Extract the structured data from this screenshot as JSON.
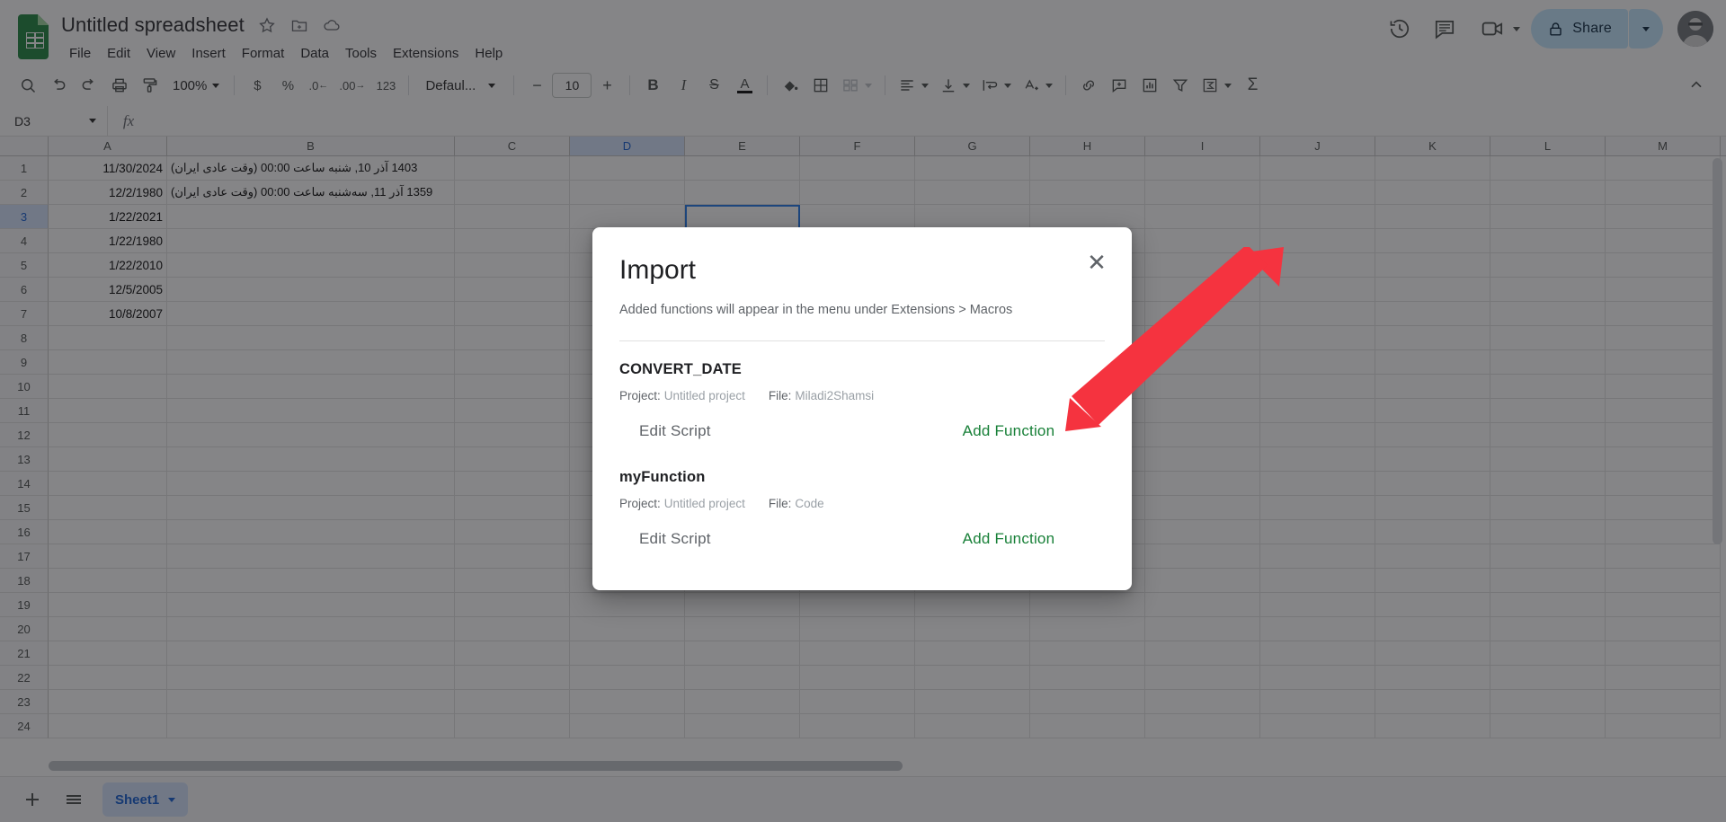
{
  "app": {
    "doc_title": "Untitled spreadsheet",
    "logo_name": "google-sheets-logo"
  },
  "header": {
    "title_icons": [
      {
        "name": "star-icon",
        "glyph": "☆"
      },
      {
        "name": "move-to-folder-icon",
        "glyph": "▣"
      },
      {
        "name": "cloud-saved-icon",
        "glyph": "☁"
      }
    ],
    "menus": [
      {
        "label": "File"
      },
      {
        "label": "Edit"
      },
      {
        "label": "View"
      },
      {
        "label": "Insert"
      },
      {
        "label": "Format"
      },
      {
        "label": "Data"
      },
      {
        "label": "Tools"
      },
      {
        "label": "Extensions"
      },
      {
        "label": "Help"
      }
    ],
    "right": {
      "history_icon": "version-history-icon",
      "comment_icon": "comment-history-icon",
      "meet_icon": "google-meet-icon",
      "share_label": "Share",
      "share_lock_icon": "lock-icon",
      "avatar": "account-avatar"
    }
  },
  "toolbar": {
    "zoom_value": "100%",
    "font_value": "Defaul...",
    "font_size": "10",
    "currency_glyph": "$",
    "percent_glyph": "%",
    "dec_dec_glyph": ".0",
    "dec_inc_glyph": ".00",
    "formats_glyph": "123",
    "bold_glyph": "B",
    "italic_glyph": "I",
    "strike_glyph": "S",
    "textcolor_glyph": "A",
    "minus_glyph": "−",
    "plus_glyph": "+",
    "sum_glyph": "Σ",
    "items": [
      {
        "name": "search-icon"
      },
      {
        "name": "undo-icon"
      },
      {
        "name": "redo-icon"
      },
      {
        "name": "print-icon"
      },
      {
        "name": "paint-format-icon"
      },
      {
        "name": "fill-color-icon"
      },
      {
        "name": "borders-icon"
      },
      {
        "name": "merge-cells-icon"
      },
      {
        "name": "horizontal-align-icon"
      },
      {
        "name": "vertical-align-icon"
      },
      {
        "name": "text-wrapping-icon"
      },
      {
        "name": "text-rotation-icon"
      },
      {
        "name": "insert-link-icon"
      },
      {
        "name": "insert-comment-icon"
      },
      {
        "name": "insert-chart-icon"
      },
      {
        "name": "create-filter-icon"
      },
      {
        "name": "functions-icon"
      },
      {
        "name": "collapse-toolbar-icon"
      }
    ]
  },
  "formula_bar": {
    "name_box": "D3",
    "fx_glyph": "fx",
    "formula_value": ""
  },
  "grid": {
    "columns": [
      "A",
      "B",
      "C",
      "D",
      "E",
      "F",
      "G",
      "H",
      "I",
      "J",
      "K",
      "L",
      "M"
    ],
    "selected_column": "D",
    "selected_row": 3,
    "selected_cell": "D3",
    "rows": [
      {
        "num": "1",
        "a": "11/30/2024",
        "b": "1403 آذر 10, شنبه ساعت 00:00 (وقت عادی ایران)"
      },
      {
        "num": "2",
        "a": "12/2/1980",
        "b": "1359 آذر 11, سه‌شنبه ساعت 00:00 (وقت عادی ایران)"
      },
      {
        "num": "3",
        "a": "1/22/2021",
        "b": ""
      },
      {
        "num": "4",
        "a": "1/22/1980",
        "b": ""
      },
      {
        "num": "5",
        "a": "1/22/2010",
        "b": ""
      },
      {
        "num": "6",
        "a": "12/5/2005",
        "b": ""
      },
      {
        "num": "7",
        "a": "10/8/2007",
        "b": ""
      },
      {
        "num": "8",
        "a": "",
        "b": ""
      },
      {
        "num": "9",
        "a": "",
        "b": ""
      },
      {
        "num": "10",
        "a": "",
        "b": ""
      },
      {
        "num": "11",
        "a": "",
        "b": ""
      },
      {
        "num": "12",
        "a": "",
        "b": ""
      },
      {
        "num": "13",
        "a": "",
        "b": ""
      },
      {
        "num": "14",
        "a": "",
        "b": ""
      },
      {
        "num": "15",
        "a": "",
        "b": ""
      },
      {
        "num": "16",
        "a": "",
        "b": ""
      },
      {
        "num": "17",
        "a": "",
        "b": ""
      },
      {
        "num": "18",
        "a": "",
        "b": ""
      },
      {
        "num": "19",
        "a": "",
        "b": ""
      },
      {
        "num": "20",
        "a": "",
        "b": ""
      },
      {
        "num": "21",
        "a": "",
        "b": ""
      },
      {
        "num": "22",
        "a": "",
        "b": ""
      },
      {
        "num": "23",
        "a": "",
        "b": ""
      },
      {
        "num": "24",
        "a": "",
        "b": ""
      }
    ]
  },
  "sheetbar": {
    "add_label": "+",
    "all_sheets_icon": "all-sheets-icon",
    "tab_label": "Sheet1"
  },
  "modal": {
    "title": "Import",
    "subtitle": "Added functions will appear in the menu under Extensions > Macros",
    "close_glyph": "✕",
    "project_label": "Project:",
    "file_label": "File:",
    "functions": [
      {
        "name": "CONVERT_DATE",
        "project": "Untitled project",
        "file": "Miladi2Shamsi",
        "edit_label": "Edit Script",
        "add_label": "Add Function"
      },
      {
        "name": "myFunction",
        "project": "Untitled project",
        "file": "Code",
        "edit_label": "Edit Script",
        "add_label": "Add Function"
      }
    ]
  },
  "annotation": {
    "arrow_color": "#f5333f",
    "arrow_name": "red-pointer-arrow"
  },
  "colors": {
    "sheets_green": "#188038",
    "share_blue": "#c2e7ff",
    "selection_blue": "#1a73e8",
    "header_sel": "#d3e3fd"
  }
}
